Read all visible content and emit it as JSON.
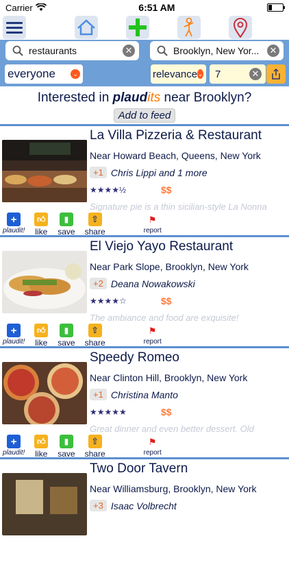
{
  "status": {
    "carrier": "Carrier",
    "time": "6:51 AM"
  },
  "toolbar": {
    "icons": [
      "menu-icon",
      "home-icon",
      "plus-icon",
      "person-icon",
      "location-pin-icon"
    ]
  },
  "search": {
    "query": "restaurants",
    "location": "Brooklyn, New Yor...",
    "audience": "everyone",
    "sort": "relevance",
    "days": "7"
  },
  "banner": {
    "prefix": "Interested in ",
    "brand_a": "plaud",
    "brand_b": "its",
    "suffix": " near Brooklyn?",
    "add_feed": "Add to feed"
  },
  "actions": {
    "plaudit": "plaudit!",
    "like": "like",
    "save": "save",
    "share": "share",
    "report": "report"
  },
  "cards": [
    {
      "name": "La Villa Pizzeria & Restaurant",
      "location": "Near Howard Beach, Queens, New York",
      "plaud_count": "+1",
      "plauders": "Chris Lippi and 1 more",
      "stars": "★★★★½",
      "price": "$$",
      "review": "Signature pie is a thin sicilian-style La Nonna"
    },
    {
      "name": "El Viejo Yayo Restaurant",
      "location": "Near Park Slope, Brooklyn, New York",
      "plaud_count": "+2",
      "plauders": "Deana Nowakowski",
      "stars": "★★★★☆",
      "price": "$$",
      "review": "The ambiance and food are exquisite!"
    },
    {
      "name": "Speedy Romeo",
      "location": "Near Clinton Hill, Brooklyn, New York",
      "plaud_count": "+1",
      "plauders": "Christina Manto",
      "stars": "★★★★★",
      "price": "$$",
      "review": "Great dinner and even better dessert. Old"
    },
    {
      "name": "Two Door Tavern",
      "location": "Near Williamsburg, Brooklyn, New York",
      "plaud_count": "+3",
      "plauders": "Isaac Volbrecht",
      "stars": "",
      "price": "",
      "review": ""
    }
  ],
  "colors": {
    "accent_blue": "#6e9fd6",
    "navy_text": "#0d1a4a",
    "orange": "#ff7a00",
    "divider": "#5b8fd0"
  }
}
